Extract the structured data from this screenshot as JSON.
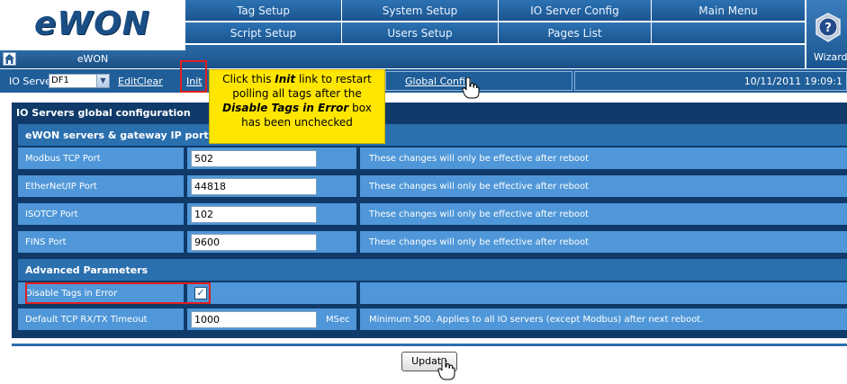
{
  "logo": {
    "brand": "eWON",
    "subtitle": "eWON"
  },
  "nav": {
    "row1": [
      "Tag Setup",
      "System Setup",
      "IO Server Config",
      "Main Menu"
    ],
    "row2": [
      "Script Setup",
      "Users Setup",
      "Pages List"
    ],
    "wizards_label": "Wizards"
  },
  "ioserver": {
    "label": "IO Server:",
    "selected": "DF1",
    "edit": "Edit",
    "clear": "Clear",
    "init": "Init",
    "global_config": "Global Config",
    "datetime": "10/11/2011 19:09:1"
  },
  "callout": {
    "line1": "Click this ",
    "init": "Init",
    "line1b": " link to restart",
    "line2": "polling all tags after the",
    "emph": "Disable Tags in Error",
    "line3b": " box",
    "line4": "has been unchecked"
  },
  "panel": {
    "title": "IO Servers global configuration",
    "section1": "eWON servers & gateway IP ports",
    "rows": [
      {
        "label": "Modbus TCP Port",
        "value": "502",
        "note": "These changes will only be effective after reboot"
      },
      {
        "label": "EtherNet/IP Port",
        "value": "44818",
        "note": "These changes will only be effective after reboot"
      },
      {
        "label": "ISOTCP Port",
        "value": "102",
        "note": "These changes will only be effective after reboot"
      },
      {
        "label": "FINS Port",
        "value": "9600",
        "note": "These changes will only be effective after reboot"
      }
    ],
    "section2": "Advanced Parameters",
    "disable_tags": {
      "label": "Disable Tags in Error",
      "checked": "✓"
    },
    "timeout": {
      "label": "Default TCP RX/TX Timeout",
      "value": "1000",
      "unit": "MSec",
      "note": "Minimum 500. Applies to all IO servers (except Modbus) after next reboot."
    }
  },
  "update_label": "Update",
  "colors": {
    "nav": "#1a5590",
    "panel": "#0f3a6a",
    "row": "#4f97d8",
    "callout": "#ffe600",
    "highlight": "#e02020"
  }
}
